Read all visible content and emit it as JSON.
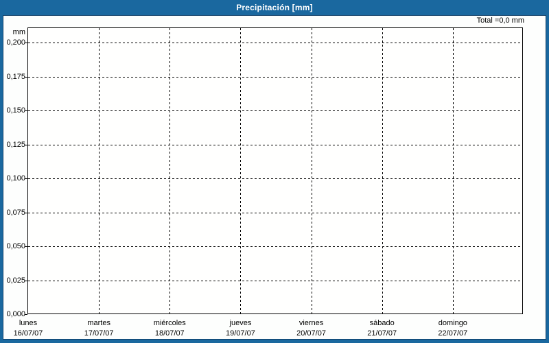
{
  "window": {
    "title": "Precipitación [mm]"
  },
  "summary": {
    "total_label": "Total =0,0 mm"
  },
  "axis": {
    "unit_label": "mm"
  },
  "colors": {
    "titlebar_blue": "#1a689f",
    "panel_border": "#0d3d66",
    "panel_bg": "#fdfefd",
    "grid_black": "#000000",
    "title_text": "#ffffff"
  },
  "chart_data": {
    "type": "bar",
    "title": "Precipitación [mm]",
    "ylabel": "mm",
    "ylim": [
      0,
      0.21
    ],
    "grid": "dashed",
    "legend": "none",
    "total": "0,0 mm",
    "y_ticks": [
      {
        "value": 0.2,
        "label": "0,200"
      },
      {
        "value": 0.175,
        "label": "0,175"
      },
      {
        "value": 0.15,
        "label": "0,150"
      },
      {
        "value": 0.125,
        "label": "0,125"
      },
      {
        "value": 0.1,
        "label": "0,100"
      },
      {
        "value": 0.075,
        "label": "0,075"
      },
      {
        "value": 0.05,
        "label": "0,050"
      },
      {
        "value": 0.025,
        "label": "0,025"
      },
      {
        "value": 0.0,
        "label": "0,000"
      }
    ],
    "categories": [
      {
        "day": "lunes",
        "date": "16/07/07"
      },
      {
        "day": "martes",
        "date": "17/07/07"
      },
      {
        "day": "miércoles",
        "date": "18/07/07"
      },
      {
        "day": "jueves",
        "date": "19/07/07"
      },
      {
        "day": "viernes",
        "date": "20/07/07"
      },
      {
        "day": "sábado",
        "date": "21/07/07"
      },
      {
        "day": "domingo",
        "date": "22/07/07"
      }
    ],
    "series": [
      {
        "name": "Precipitación",
        "values": [
          0,
          0,
          0,
          0,
          0,
          0,
          0
        ]
      }
    ]
  }
}
